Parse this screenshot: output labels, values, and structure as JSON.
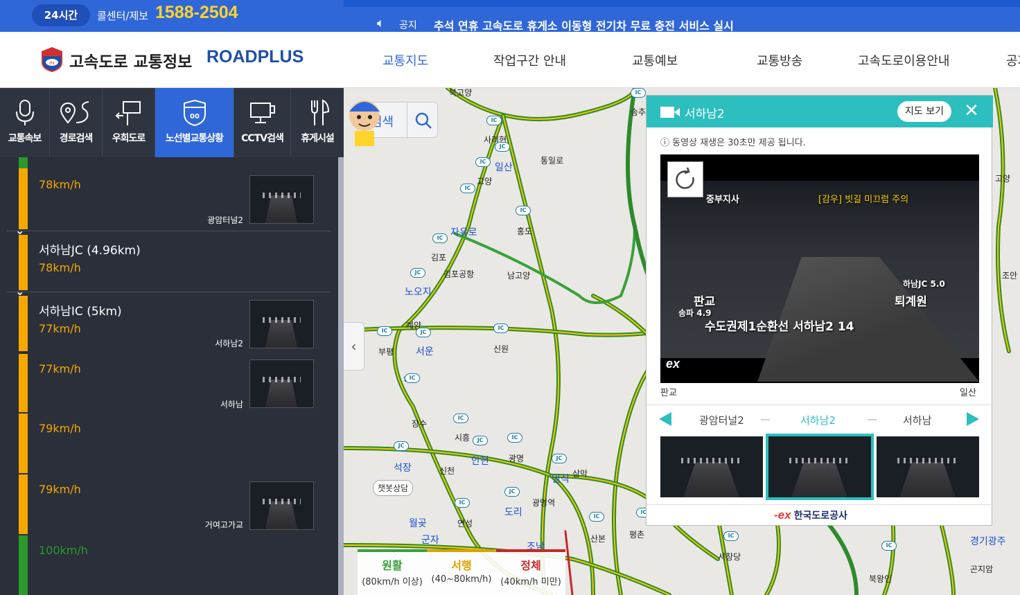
{
  "topbar": {
    "badge": "24시간",
    "callcenter_label": "콜센터/제보",
    "phone": "1588-2504",
    "notice_label": "공지",
    "notice_text": "추석 연휴 고속도로 휴게소 이동형 전기차 무료 충전 서비스 실시"
  },
  "header": {
    "logo_text": "고속도로 교통정보",
    "logo_brand": "ROADPLUS",
    "nav": [
      "교통지도",
      "작업구간 안내",
      "교통예보",
      "교통방송",
      "고속도로이용안내",
      "공지"
    ]
  },
  "tabs": [
    "교통속보",
    "경로검색",
    "우회도로",
    "노선별교통상황",
    "CCTV검색",
    "휴게시설"
  ],
  "sections": [
    {
      "speed": "78km/h",
      "camera": "광암터널2"
    },
    {
      "title": "서하남JC (4.96km)",
      "speed": "78km/h"
    },
    {
      "title": "서하남IC (5km)",
      "speed": "77km/h",
      "camera": "서하남2"
    },
    {
      "speed": "77km/h",
      "camera": "서하남"
    },
    {
      "speed": "79km/h"
    },
    {
      "speed": "79km/h",
      "camera": "거여고가교"
    },
    {
      "speed": "100km/h"
    }
  ],
  "map": {
    "search_label": "검색",
    "mascot_bubble": "챗봇상담",
    "labels": [
      "북고양",
      "송추",
      "사리현",
      "통일로",
      "고양",
      "일산",
      "자유로",
      "홍도",
      "김포",
      "김포공항",
      "남고양",
      "노오지",
      "계양",
      "서운",
      "부평",
      "신원",
      "송내",
      "장수",
      "시흥",
      "안현",
      "광명",
      "석장",
      "신천",
      "일직",
      "삼막",
      "광명역",
      "월곶",
      "연성",
      "도리",
      "조남",
      "산본",
      "평촌",
      "군자",
      "서창당",
      "북왕인",
      "곤지암",
      "경기광주",
      "조안",
      "고양"
    ],
    "legend": [
      {
        "name": "원활",
        "range": "(80km/h 이상)",
        "color": "#3aa03a"
      },
      {
        "name": "서행",
        "range": "(40~80km/h)",
        "color": "#e0a000"
      },
      {
        "name": "정체",
        "range": "(40km/h 미만)",
        "color": "#c62828"
      }
    ]
  },
  "popup": {
    "title": "서하남2",
    "map_button": "지도 보기",
    "note": "동영상 재생은 30초만 제공 됩니다.",
    "video": {
      "top_left": "중부지사",
      "warning": "[감우] 빗길 미끄럼 주의",
      "left_dir": "판교",
      "left_sub": "송파 4.9",
      "right_sub": "하남JC 5.0",
      "right_dir": "퇴계원",
      "caption": "수도권제1순환선  서하남2  14",
      "logo": "ex"
    },
    "dir_left": "판교",
    "dir_right": "일산",
    "carousel": [
      "광암터널2",
      "서하남2",
      "서하남"
    ],
    "footer": "한국도로공사"
  },
  "colors": {
    "accent": "#2f67d8",
    "teal": "#2dbebe",
    "slow": "#f5a800",
    "free": "#2a9a2a"
  }
}
